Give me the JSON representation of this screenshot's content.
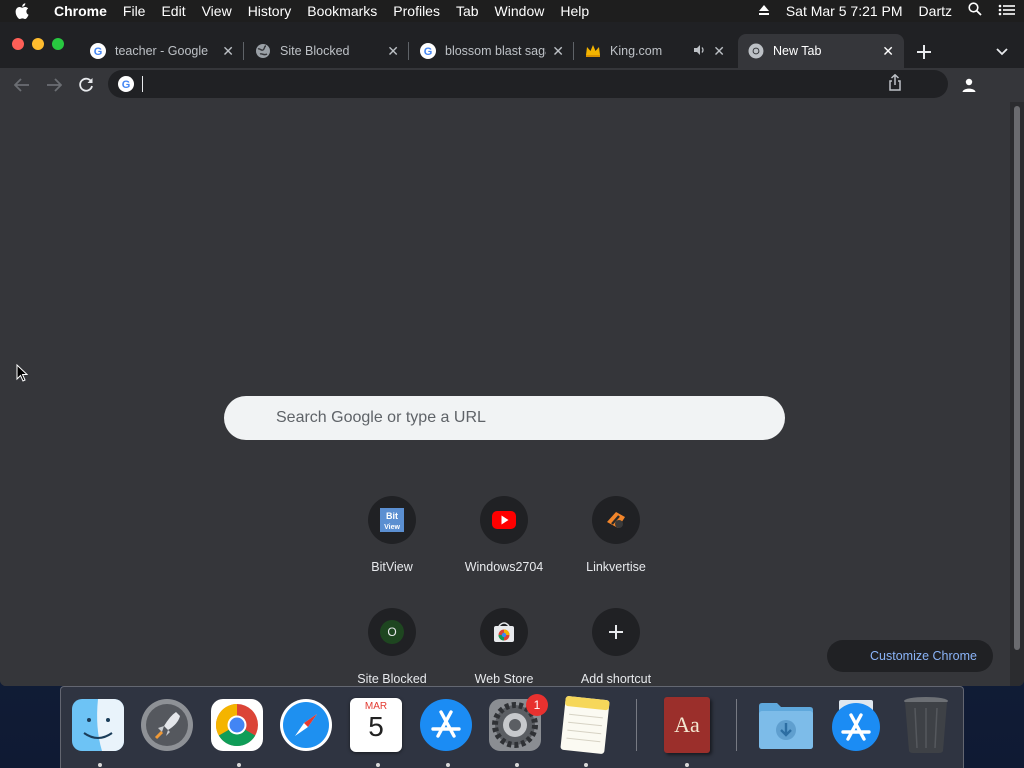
{
  "menubar": {
    "app_name": "Chrome",
    "menus": [
      "File",
      "Edit",
      "View",
      "History",
      "Bookmarks",
      "Profiles",
      "Tab",
      "Window",
      "Help"
    ],
    "datetime": "Sat Mar 5  7:21 PM",
    "user": "Dartz"
  },
  "tabs": [
    {
      "label": "teacher - Google",
      "icon": "google-icon"
    },
    {
      "label": "Site Blocked",
      "icon": "globe-icon"
    },
    {
      "label": "blossom blast saga",
      "icon": "google-icon"
    },
    {
      "label": "King.com",
      "icon": "king-crown-icon",
      "audio": true
    },
    {
      "label": "New Tab",
      "icon": "chrome-icon",
      "active": true
    }
  ],
  "omnibox": {
    "value": "",
    "placeholder": ""
  },
  "search": {
    "placeholder": "Search Google or type a URL"
  },
  "shortcuts": [
    {
      "label": "BitView",
      "icon": "bitview-icon"
    },
    {
      "label": "Windows2704",
      "icon": "youtube-icon"
    },
    {
      "label": "Linkvertise",
      "icon": "linkvertise-icon"
    },
    {
      "label": "Site Blocked",
      "icon": "letter-o-icon",
      "letter": "O"
    },
    {
      "label": "Web Store",
      "icon": "web-store-icon"
    },
    {
      "label": "Add shortcut",
      "icon": "plus-icon"
    }
  ],
  "customize": {
    "label": "Customize Chrome"
  },
  "dock": {
    "items": [
      "Finder",
      "Launchpad",
      "Google Chrome",
      "Safari",
      "Calendar",
      "App Store",
      "System Preferences",
      "Notes",
      "Dictionary",
      "Downloads",
      "App Store",
      "Trash"
    ],
    "calendar": {
      "month": "MAR",
      "day": "5"
    },
    "sysprefs_badge": "1",
    "dictionary_text": "Aa"
  },
  "colors": {
    "window_bg": "#35363a",
    "tabstrip_bg": "#202124",
    "accent": "#8ab4f8",
    "close": "#ff5f57",
    "minimize": "#febc2e",
    "zoom": "#28c840"
  }
}
